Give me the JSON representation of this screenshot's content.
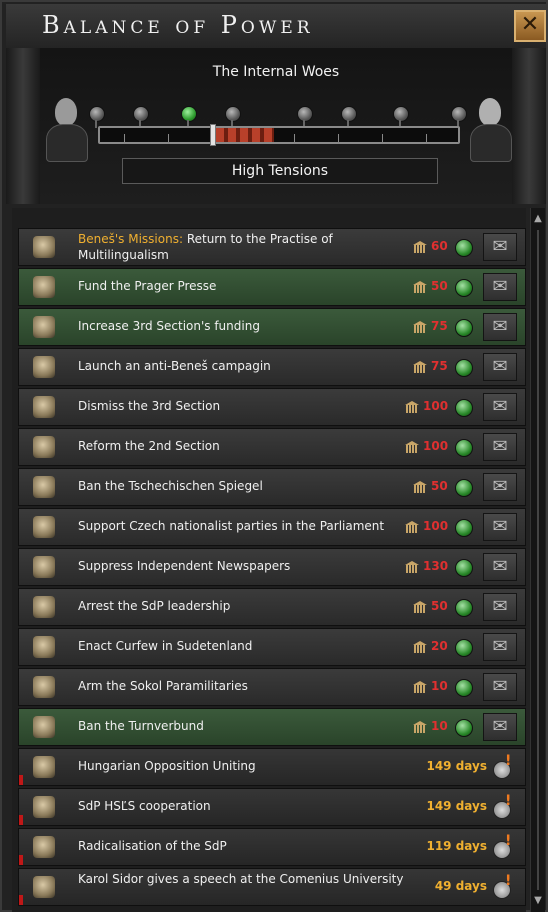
{
  "window": {
    "title": "Balance of Power",
    "close_icon": "close-icon"
  },
  "balance": {
    "title": "The Internal Woes",
    "status": "High Tensions",
    "left_portrait": "bust-left-icon",
    "right_portrait": "bust-right-icon",
    "active_node": 2
  },
  "decisions": [
    {
      "icon": "statue-icon",
      "highlight": "Beneš's Missions:",
      "label": " Return to the Practise of Multilingualism",
      "cost": "60",
      "green": false
    },
    {
      "icon": "megaphone-icon",
      "label": "Fund the Prager Presse",
      "cost": "50",
      "green": true
    },
    {
      "icon": "documents-icon",
      "label": "Increase 3rd Section's funding",
      "cost": "75",
      "green": true
    },
    {
      "icon": "megaphone-icon",
      "label": "Launch an anti-Beneš campagin",
      "cost": "75",
      "green": false
    },
    {
      "icon": "document-icon",
      "label": "Dismiss the 3rd Section",
      "cost": "100",
      "green": false
    },
    {
      "icon": "agent-icon",
      "label": "Reform the 2nd Section",
      "cost": "100",
      "green": false
    },
    {
      "icon": "handcuffs-icon",
      "label": "Ban the Tschechischen Spiegel",
      "cost": "50",
      "green": false
    },
    {
      "icon": "soldiers-icon",
      "label": "Support Czech nationalist parties in the Parliament",
      "cost": "100",
      "green": false
    },
    {
      "icon": "handcuffs-icon",
      "label": "Suppress Independent Newspapers",
      "cost": "130",
      "green": false
    },
    {
      "icon": "helmet-icon",
      "label": "Arrest the SdP leadership",
      "cost": "50",
      "green": false
    },
    {
      "icon": "helmet-icon",
      "label": "Enact Curfew in Sudetenland",
      "cost": "20",
      "green": false
    },
    {
      "icon": "soldiers-icon",
      "label": "Arm the Sokol Paramilitaries",
      "cost": "10",
      "green": false
    },
    {
      "icon": "handcuffs-icon",
      "label": "Ban the Turnverbund",
      "cost": "10",
      "green": true
    }
  ],
  "missions": [
    {
      "icon": "handshake-icon",
      "label": "Hungarian Opposition Uniting",
      "days": "149 days"
    },
    {
      "icon": "handshake-icon",
      "label": "SdP HSĽS cooperation",
      "days": "149 days"
    },
    {
      "icon": "eagle-icon",
      "label": "Radicalisation of the SdP",
      "days": "119 days"
    },
    {
      "icon": "speaker-icon",
      "label": "Karol Sidor gives a speech at the Comenius University",
      "days": "49 days"
    }
  ],
  "scrollbar": {
    "up_icon": "scroll-up-icon",
    "down_icon": "scroll-down-icon"
  }
}
